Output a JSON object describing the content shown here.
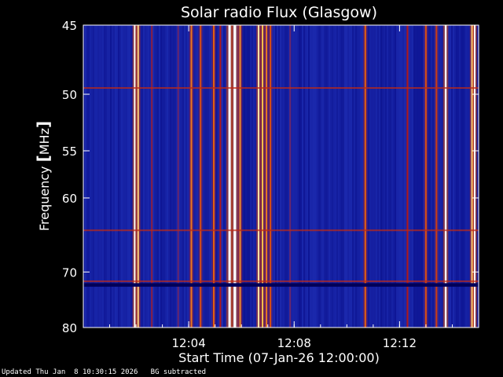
{
  "chart_data": {
    "type": "heatmap",
    "title": "Solar radio Flux (Glasgow)",
    "xlabel": "Start Time (07-Jan-26 12:00:00)",
    "ylabel_text": "Frequency ",
    "ylabel_unit": "MHz",
    "x_range_minutes": [
      0,
      15
    ],
    "x_ticks": [
      {
        "minute": 4,
        "label": "12:04"
      },
      {
        "minute": 8,
        "label": "12:08"
      },
      {
        "minute": 12,
        "label": "12:12"
      }
    ],
    "y_range_mhz": [
      45,
      80
    ],
    "y_scale": "reciprocal",
    "y_ticks": [
      45,
      50,
      55,
      60,
      70,
      80
    ],
    "y_tick_labels": [
      "45",
      "50",
      "55",
      "60",
      "70",
      "80"
    ],
    "colormap": [
      "#00007a",
      "#2233bb",
      "#b01818",
      "#e35f10",
      "#ffc04a",
      "#ffffff"
    ],
    "background_level": 0.12,
    "emission_bursts": [
      {
        "minute": 1.95,
        "intensity": 0.95,
        "width_min": 0.06
      },
      {
        "minute": 2.08,
        "intensity": 0.85,
        "width_min": 0.05
      },
      {
        "minute": 2.6,
        "intensity": 0.35,
        "width_min": 0.04
      },
      {
        "minute": 3.6,
        "intensity": 0.3,
        "width_min": 0.04
      },
      {
        "minute": 4.1,
        "intensity": 0.65,
        "width_min": 0.05
      },
      {
        "minute": 4.45,
        "intensity": 0.55,
        "width_min": 0.05
      },
      {
        "minute": 4.95,
        "intensity": 0.6,
        "width_min": 0.04
      },
      {
        "minute": 5.2,
        "intensity": 0.4,
        "width_min": 0.04
      },
      {
        "minute": 5.55,
        "intensity": 1.0,
        "width_min": 0.09
      },
      {
        "minute": 5.75,
        "intensity": 1.0,
        "width_min": 0.1
      },
      {
        "minute": 5.95,
        "intensity": 0.7,
        "width_min": 0.05
      },
      {
        "minute": 6.65,
        "intensity": 0.9,
        "width_min": 0.05
      },
      {
        "minute": 6.8,
        "intensity": 0.8,
        "width_min": 0.05
      },
      {
        "minute": 6.95,
        "intensity": 0.65,
        "width_min": 0.04
      },
      {
        "minute": 7.1,
        "intensity": 0.55,
        "width_min": 0.04
      },
      {
        "minute": 7.85,
        "intensity": 0.3,
        "width_min": 0.04
      },
      {
        "minute": 10.7,
        "intensity": 0.6,
        "width_min": 0.06
      },
      {
        "minute": 12.3,
        "intensity": 0.4,
        "width_min": 0.04
      },
      {
        "minute": 13.0,
        "intensity": 0.55,
        "width_min": 0.05
      },
      {
        "minute": 13.4,
        "intensity": 0.5,
        "width_min": 0.05
      },
      {
        "minute": 13.75,
        "intensity": 1.0,
        "width_min": 0.07
      },
      {
        "minute": 14.75,
        "intensity": 0.85,
        "width_min": 0.06
      },
      {
        "minute": 14.85,
        "intensity": 1.0,
        "width_min": 0.06
      }
    ],
    "interference_lines_mhz": [
      49.5,
      64.0,
      71.5
    ],
    "blank_band_mhz": [
      71.8,
      72.4
    ]
  },
  "footer": {
    "updated": "Updated Thu Jan  8 10:30:15 2026",
    "note": "BG subtracted"
  }
}
